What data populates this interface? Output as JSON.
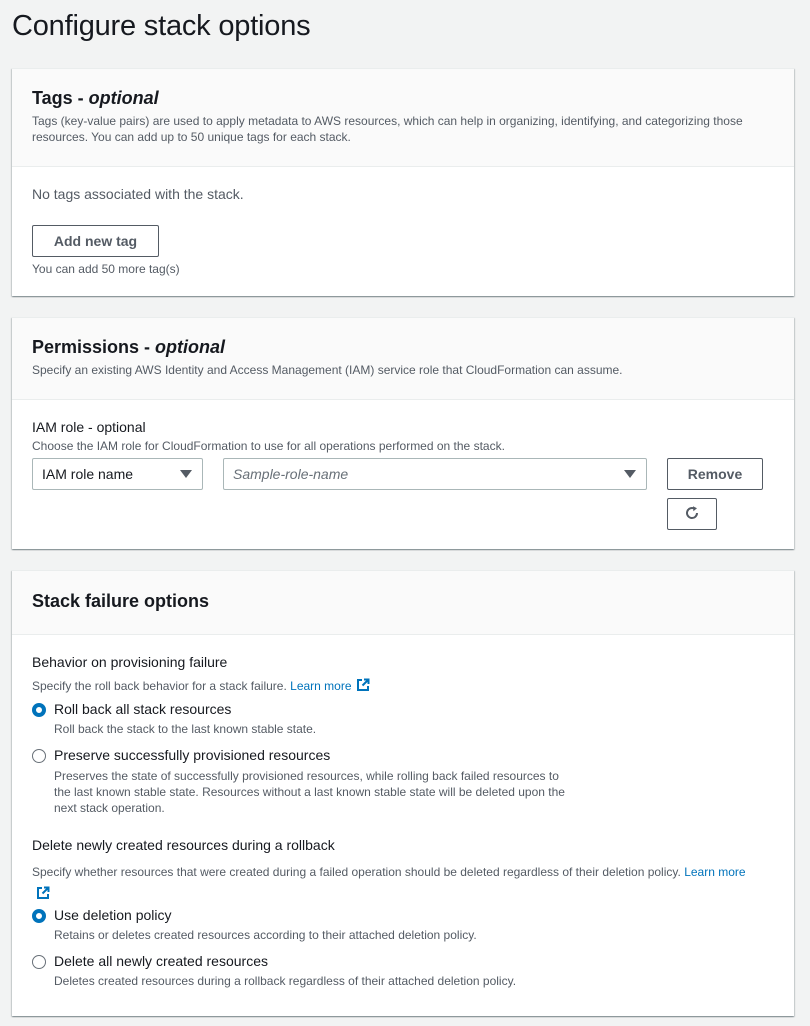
{
  "page": {
    "title": "Configure stack options"
  },
  "tags": {
    "title": "Tags - ",
    "title_optional": "optional",
    "description": "Tags (key-value pairs) are used to apply metadata to AWS resources, which can help in organizing, identifying, and categorizing those resources. You can add up to 50 unique tags for each stack.",
    "empty_text": "No tags associated with the stack.",
    "add_button": "Add new tag",
    "remaining_text": "You can add 50 more tag(s)"
  },
  "permissions": {
    "title": "Permissions - ",
    "title_optional": "optional",
    "description": "Specify an existing AWS Identity and Access Management (IAM) service role that CloudFormation can assume.",
    "field_label": "IAM role - optional",
    "field_description": "Choose the IAM role for CloudFormation to use for all operations performed on the stack.",
    "role_type_value": "IAM role name",
    "role_name_placeholder": "Sample-role-name",
    "remove_button": "Remove",
    "refresh_icon": "refresh-icon"
  },
  "failure": {
    "title": "Stack failure options",
    "behavior": {
      "label": "Behavior on provisioning failure",
      "description": "Specify the roll back behavior for a stack failure.",
      "learn_more": "Learn more",
      "options": [
        {
          "label": "Roll back all stack resources",
          "description": "Roll back the stack to the last known stable state.",
          "checked": true
        },
        {
          "label": "Preserve successfully provisioned resources",
          "description_lines": [
            "Preserves the state of successfully provisioned resources, while rolling back failed resources to",
            "the last known stable state. Resources without a last known stable state will be deleted upon the",
            "next stack operation."
          ],
          "checked": false
        }
      ]
    },
    "delete": {
      "label": "Delete newly created resources during a rollback",
      "description": "Specify whether resources that were created during a failed operation should be deleted regardless of their deletion policy.",
      "learn_more_1": "Learn",
      "learn_more_2": "more",
      "options": [
        {
          "label": "Use deletion policy",
          "description": "Retains or deletes created resources according to their attached deletion policy.",
          "checked": true
        },
        {
          "label": "Delete all newly created resources",
          "description": "Deletes created resources during a rollback regardless of their attached deletion policy.",
          "checked": false
        }
      ]
    }
  },
  "colors": {
    "accent": "#0073bb",
    "text": "#16191f",
    "muted": "#545b64"
  }
}
